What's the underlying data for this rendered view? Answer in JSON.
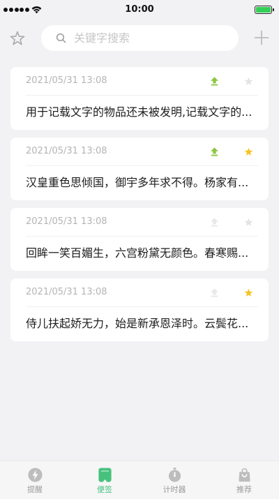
{
  "status_bar": {
    "time": "10:00",
    "signal_level": 5,
    "battery_level": 1,
    "icons": [
      "cellular-signal-icon",
      "wifi-icon",
      "battery-icon"
    ]
  },
  "header": {
    "left_icon": "star-outline-icon",
    "search_icon": "search-icon",
    "search_placeholder": "关键字搜索",
    "search_value": "",
    "right_icon": "plus-icon"
  },
  "note_icons": {
    "pin": "pin-to-top-icon",
    "star": "star-icon"
  },
  "notes": [
    {
      "date": "2021/05/31 13:08",
      "text": "用于记载文字的物品还未被发明,记载文字的...",
      "pinned": true,
      "starred": false
    },
    {
      "date": "2021/05/31 13:08",
      "text": "汉皇重色思倾国，御宇多年求不得。杨家有...",
      "pinned": true,
      "starred": true
    },
    {
      "date": "2021/05/31 13:08",
      "text": "回眸一笑百媚生，六宫粉黛无颜色。春寒赐...",
      "pinned": false,
      "starred": false
    },
    {
      "date": "2021/05/31 13:08",
      "text": "侍儿扶起娇无力，始是新承恩泽时。云鬓花...",
      "pinned": false,
      "starred": true
    }
  ],
  "tabbar": {
    "items": [
      {
        "label": "提醒",
        "icon": "reminder-bolt-icon",
        "active": false
      },
      {
        "label": "便签",
        "icon": "notebook-icon",
        "active": true
      },
      {
        "label": "计时器",
        "icon": "stopwatch-icon",
        "active": false
      },
      {
        "label": "推荐",
        "icon": "shopping-bag-icon",
        "active": false
      }
    ]
  },
  "colors": {
    "background": "#f2f2f4",
    "card": "#ffffff",
    "pin_active": "#8cc63f",
    "pin_inactive": "#e8e8e8",
    "star_active": "#f6c324",
    "star_inactive": "#e3e3e3",
    "tab_active": "#47c27d",
    "tab_inactive": "#bdbdbd",
    "battery": "#34cf57",
    "date_text": "#b4b4b4"
  }
}
